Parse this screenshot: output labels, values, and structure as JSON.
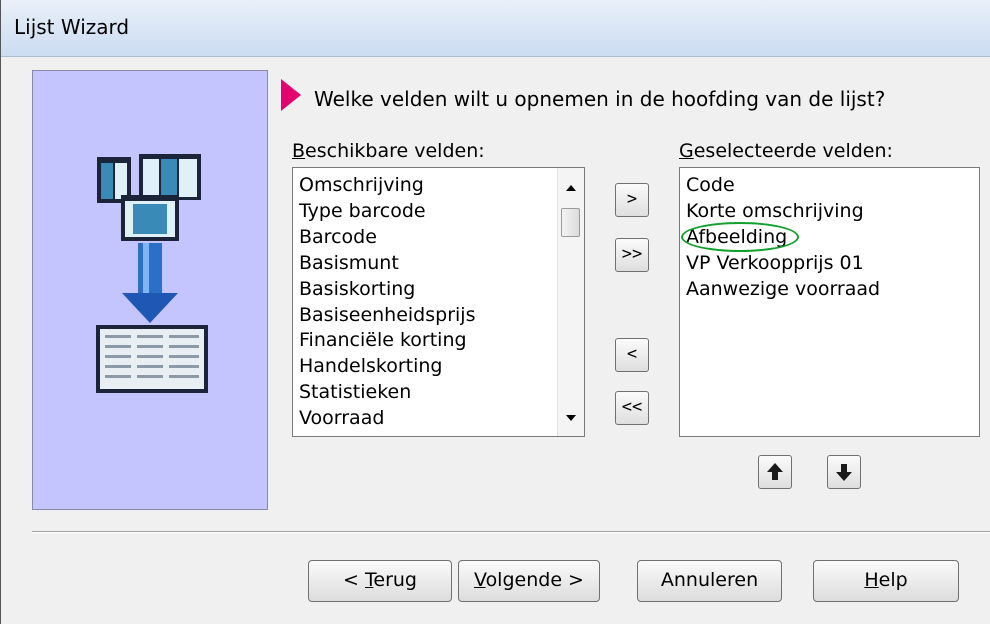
{
  "window": {
    "title": "Lijst Wizard"
  },
  "prompt": {
    "question": "Welke velden wilt u opnemen in de hoofding van de lijst?"
  },
  "available": {
    "label_first": "B",
    "label_rest": "eschikbare velden:",
    "items": [
      "Omschrijving",
      "Type barcode",
      "Barcode",
      "Basismunt",
      "Basiskorting",
      "Basiseenheidsprijs",
      "Financiële korting",
      "Handelskorting",
      "Statistieken",
      "Voorraad"
    ]
  },
  "selected": {
    "label_first": "G",
    "label_rest": "eselecteerde velden:",
    "items": [
      "Code",
      "Korte omschrijving",
      "Afbeelding",
      "VP Verkoopprijs 01",
      "Aanwezige voorraad"
    ]
  },
  "move_buttons": {
    "add": ">",
    "add_all": ">>",
    "remove": "<",
    "remove_all": "<<"
  },
  "order_buttons": {
    "up": "up-arrow-icon",
    "down": "down-arrow-icon"
  },
  "footer": {
    "back_prefix": "< ",
    "back_mnemonic": "T",
    "back_rest": "erug",
    "next_mnemonic": "V",
    "next_rest": "olgende >",
    "cancel": "Annuleren",
    "help_mnemonic": "H",
    "help_rest": "elp"
  },
  "colors": {
    "side_panel": "#c4c4ff",
    "pointer": "#e4006f",
    "highlight_circle": "#11a02c"
  }
}
